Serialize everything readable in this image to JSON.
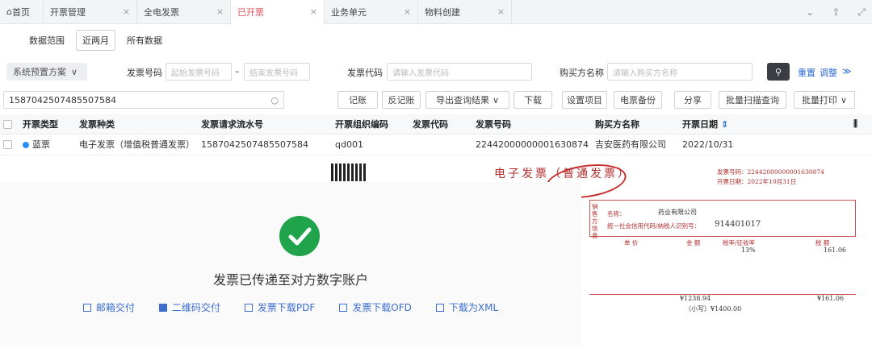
{
  "tabs": [
    {
      "label": "首页",
      "active": false
    },
    {
      "label": "开票管理",
      "active": false
    },
    {
      "label": "全电发票",
      "active": false
    },
    {
      "label": "已开票",
      "active": true
    },
    {
      "label": "业务单元",
      "active": false
    },
    {
      "label": "物料创建",
      "active": false
    }
  ],
  "tab_close": "×",
  "range": {
    "label": "数据范围",
    "options": [
      "近两月",
      "所有数据"
    ]
  },
  "filter": {
    "scheme": "系统预置方案",
    "invoice_no_label": "发票号码",
    "start_ph": "起始发票号码",
    "end_ph": "结束发票号码",
    "dash": "–",
    "code_label": "发票代码",
    "code_ph": "请输入发票代码",
    "buyer_label": "购买方名称",
    "buyer_ph": "请输入购买方名称",
    "reset": "重置",
    "adjust": "调整"
  },
  "search": {
    "value": "1587042507485507584"
  },
  "toolbar": [
    "记账",
    "反记账",
    "导出查询结果",
    "下载",
    "设置项目",
    "电票备份",
    "分享",
    "批量扫描查询",
    "批量打印"
  ],
  "table": {
    "headers": [
      "开票类型",
      "发票种类",
      "发票请求流水号",
      "开票组织编码",
      "发票代码",
      "发票号码",
      "购买方名称",
      "开票日期"
    ],
    "rows": [
      {
        "type": "蓝票",
        "kind": "电子发票（增值税普通发票）",
        "serial": "1587042507485507584",
        "org": "qd001",
        "code": "",
        "number": "22442000000001630874",
        "buyer": "吉安医药有限公司",
        "date": "2022/10/31"
      }
    ]
  },
  "success": {
    "message": "发票已传递至对方数字账户",
    "actions": [
      {
        "label": "邮箱交付"
      },
      {
        "label": "二维码交付"
      },
      {
        "label": "发票下载PDF"
      },
      {
        "label": "发票下载OFD"
      },
      {
        "label": "下载为XML"
      }
    ]
  },
  "invoice": {
    "title": "电子发票（普通发票）",
    "no_line": "发票号码：22442000000001630874",
    "date_line": "开票日期：2022年10月31日",
    "seller_side": "销售方信息",
    "name_label": "名称：",
    "name_value": "药业有限公司",
    "tax_label": "统一社会信用代码/纳税人识别号：",
    "tax_value": "914401017",
    "col_unit": "单 价",
    "col_amount": "金 额",
    "col_rate": "税率/征收率",
    "col_tax": "税 额",
    "rate": "13%",
    "tax1": "161.06",
    "total_amount": "¥1238.94",
    "total_tax": "¥161.06",
    "grand": "（小写）¥1400.00"
  },
  "colors": {
    "accent": "#2a6ad8",
    "active_tab": "#e2505a",
    "success": "#1fa34b",
    "invoice_red": "#b22d2d"
  }
}
